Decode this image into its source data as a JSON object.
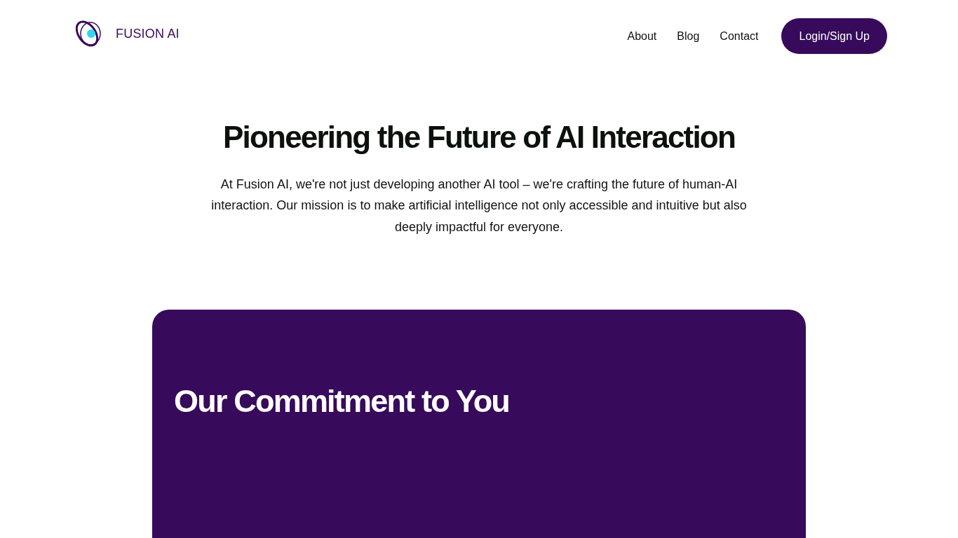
{
  "brand": {
    "name": "FUSION AI"
  },
  "nav": {
    "links": [
      "About",
      "Blog",
      "Contact"
    ],
    "cta": "Login/Sign Up"
  },
  "hero": {
    "title": "Pioneering the Future of AI Interaction",
    "text": "At Fusion AI, we're not just developing another AI tool – we're crafting the future of human-AI interaction. Our mission is to make artificial intelligence not only accessible and intuitive but also deeply impactful for everyone."
  },
  "commitment": {
    "title": "Our Commitment to You"
  }
}
